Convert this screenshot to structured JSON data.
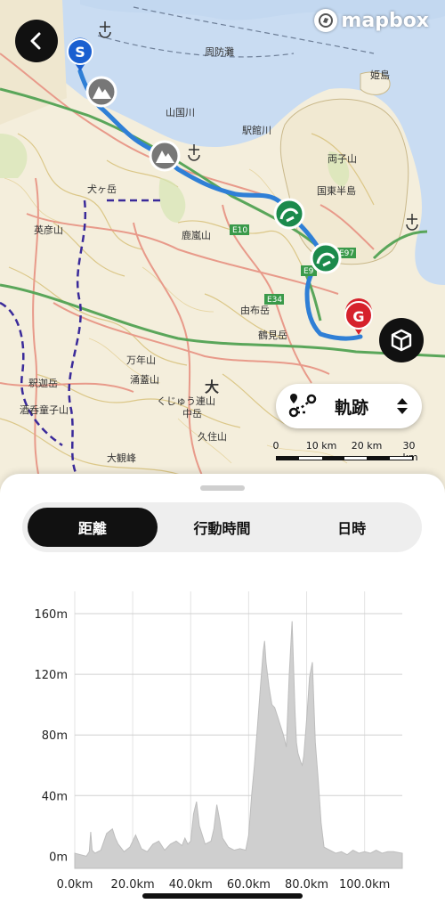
{
  "map": {
    "attribution": "mapbox",
    "start_marker": "S",
    "goal_marker": "G",
    "place_labels": [
      {
        "text": "姫島"
      },
      {
        "text": "両子山"
      },
      {
        "text": "国東半島"
      },
      {
        "text": "周防灘"
      },
      {
        "text": "駅館川"
      },
      {
        "text": "山国川"
      },
      {
        "text": "鹿嵐山"
      },
      {
        "text": "由布岳"
      },
      {
        "text": "鶴見岳"
      },
      {
        "text": "万年山"
      },
      {
        "text": "涌蓋山"
      },
      {
        "text": "くじゅう連山"
      },
      {
        "text": "中岳"
      },
      {
        "text": "久住山"
      },
      {
        "text": "大"
      },
      {
        "text": "釈迦岳"
      },
      {
        "text": "酒呑童子山"
      },
      {
        "text": "大観峰"
      },
      {
        "text": "英彦山"
      },
      {
        "text": "犬ヶ岳"
      },
      {
        "text": "E10"
      },
      {
        "text": "E97"
      },
      {
        "text": "E34"
      },
      {
        "text": "E9"
      },
      {
        "text": "0"
      },
      {
        "text": "10 km"
      },
      {
        "text": "20 km"
      },
      {
        "text": "30 km"
      }
    ],
    "layer_selector": {
      "label": "軌跡",
      "icon": "route-icon"
    },
    "scale": {
      "labels": [
        "0",
        "10 km",
        "20 km",
        "30 km"
      ]
    },
    "colors": {
      "route": "#2f7fd6",
      "sea": "#c9dcf2",
      "land": "#f4eedc",
      "goal": "#d6212c",
      "start": "#1a5fd0",
      "rest": "#1b8a4c"
    }
  },
  "sheet": {
    "tabs": [
      {
        "label": "距離",
        "active": true
      },
      {
        "label": "行動時間",
        "active": false
      },
      {
        "label": "日時",
        "active": false
      }
    ]
  },
  "chart_data": {
    "type": "area",
    "title": "",
    "xlabel": "",
    "ylabel": "",
    "x_ticks": [
      "0.0km",
      "20.0km",
      "40.0km",
      "60.0km",
      "80.0km",
      "100.0km"
    ],
    "y_ticks": [
      "0m",
      "40m",
      "80m",
      "120m",
      "160m"
    ],
    "xlim": [
      0,
      113
    ],
    "ylim": [
      -8,
      170
    ],
    "series": [
      {
        "x": [
          0,
          2,
          4,
          5,
          5.5,
          6,
          7,
          9,
          11,
          13,
          14,
          15,
          17,
          19,
          21,
          23,
          25,
          27,
          29,
          31,
          33,
          35,
          37,
          38,
          39,
          40,
          41,
          42,
          43,
          44,
          45,
          47,
          48,
          49,
          50,
          51,
          53,
          55,
          57,
          59,
          60,
          61,
          62,
          63,
          64,
          65,
          65.5,
          66,
          67,
          68,
          69,
          70,
          71,
          72,
          73,
          74,
          75,
          76,
          76.5,
          77,
          78,
          78.5,
          79,
          80,
          81,
          82,
          82.5,
          83,
          84,
          85,
          86,
          88,
          90,
          92,
          94,
          96,
          98,
          100,
          102,
          104,
          106,
          108,
          110,
          113
        ],
        "values": [
          2,
          1,
          0,
          3,
          16,
          4,
          2,
          4,
          15,
          18,
          12,
          8,
          3,
          6,
          14,
          5,
          3,
          8,
          10,
          4,
          8,
          10,
          7,
          12,
          8,
          10,
          28,
          36,
          20,
          14,
          8,
          10,
          18,
          34,
          24,
          12,
          6,
          4,
          5,
          4,
          14,
          40,
          60,
          85,
          110,
          135,
          142,
          128,
          112,
          100,
          98,
          92,
          86,
          80,
          72,
          120,
          155,
          95,
          75,
          68,
          62,
          60,
          66,
          90,
          118,
          128,
          100,
          75,
          50,
          22,
          6,
          4,
          2,
          3,
          1,
          4,
          2,
          3,
          2,
          4,
          2,
          3,
          3,
          2
        ]
      }
    ]
  }
}
